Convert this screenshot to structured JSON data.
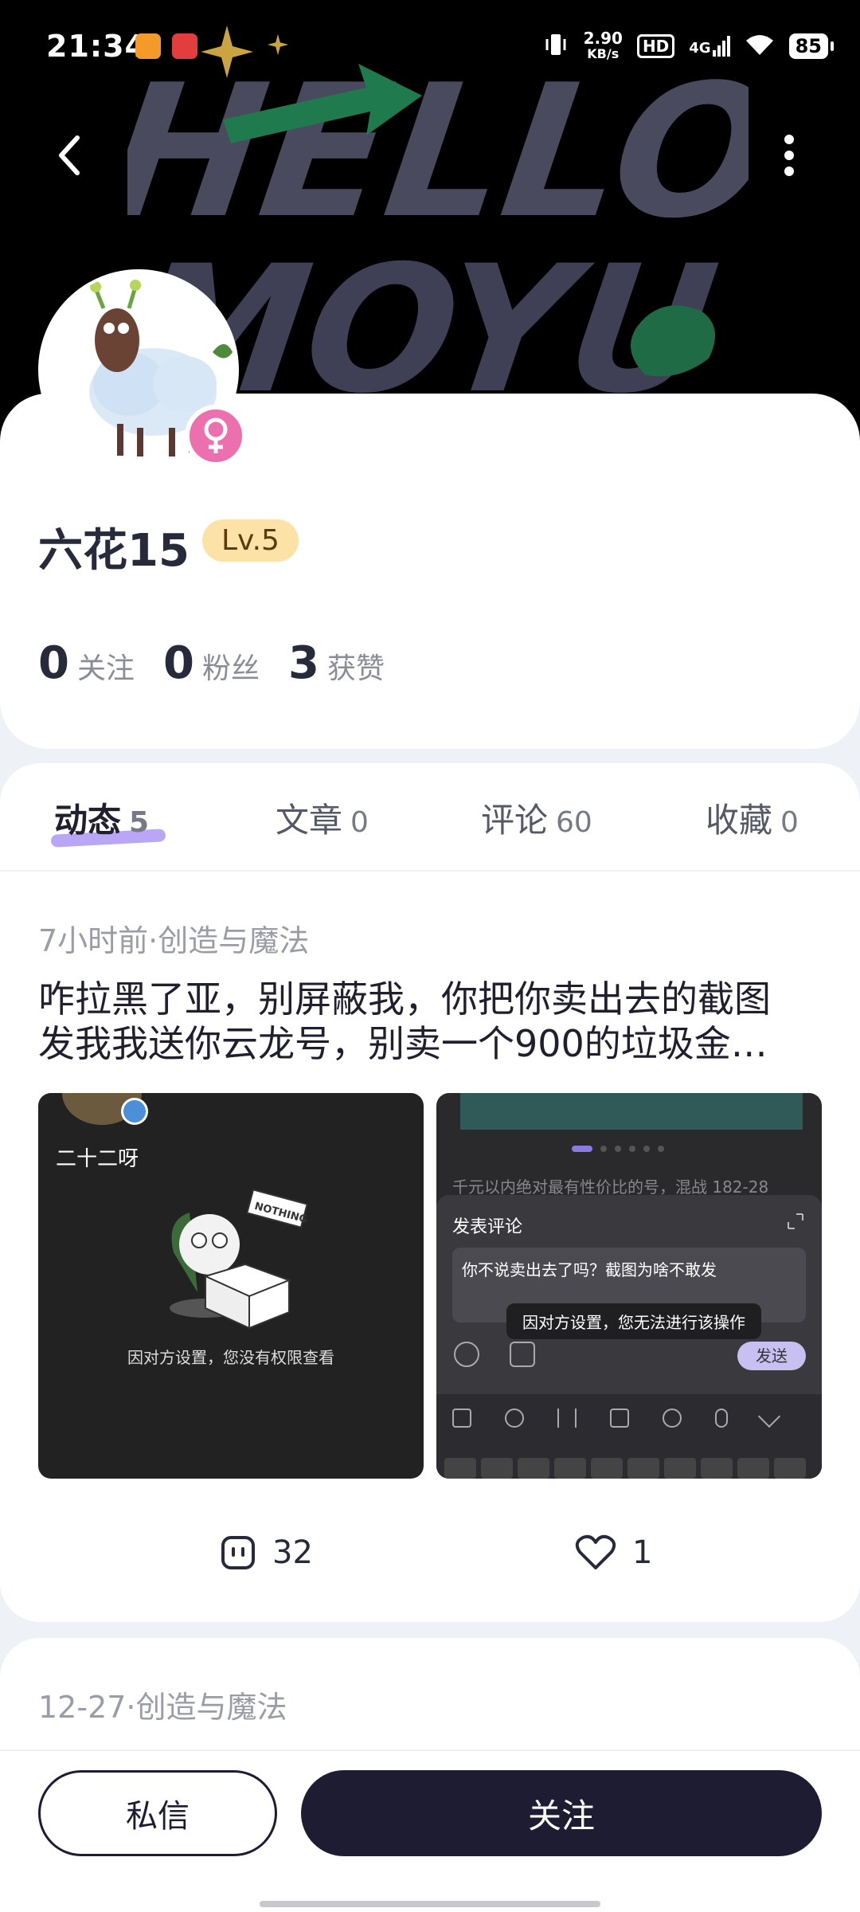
{
  "status_bar": {
    "time": "21:34",
    "net_speed_value": "2.90",
    "net_speed_unit": "KB/s",
    "hd": "HD",
    "signal": "4G",
    "battery": "85"
  },
  "header": {
    "banner_line1": "HELLO",
    "banner_line2": "MOYU"
  },
  "profile": {
    "username": "六花15",
    "level": "Lv.5",
    "stats": [
      {
        "num": "0",
        "label": "关注"
      },
      {
        "num": "0",
        "label": "粉丝"
      },
      {
        "num": "3",
        "label": "获赞"
      }
    ]
  },
  "tabs": [
    {
      "label": "动态",
      "count": "5"
    },
    {
      "label": "文章",
      "count": "0"
    },
    {
      "label": "评论",
      "count": "60"
    },
    {
      "label": "收藏",
      "count": "0"
    }
  ],
  "post": {
    "meta": "7小时前·创造与魔法",
    "text_line1": "咋拉黑了亚，别屏蔽我，你把你卖出去的截图",
    "text_line2": "发我我送你云龙号，别卖一个900的垃圾金…",
    "left_image": {
      "name": "二十二呀",
      "sticker": "NOTHING",
      "note": "因对方设置，您没有权限查看"
    },
    "right_image": {
      "top_text": "千元以内绝对最有性价比的号，混战 182-28",
      "dialog_title": "发表评论",
      "input_text": "你不说卖出去了吗？截图为啥不敢发",
      "toast": "因对方设置，您无法进行该操作",
      "send": "发送"
    },
    "comments": "32",
    "likes": "1"
  },
  "next_post": {
    "meta": "12-27·创造与魔法"
  },
  "bottom": {
    "dm": "私信",
    "follow": "关注"
  }
}
